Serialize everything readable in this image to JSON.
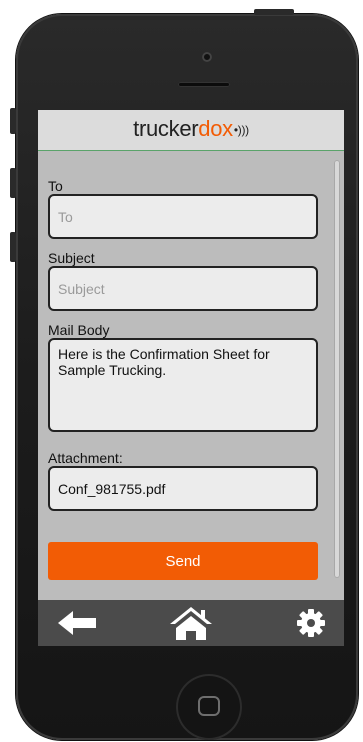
{
  "header": {
    "logo_prefix": "trucker",
    "logo_accent": "dox",
    "logo_waves": "•)))"
  },
  "form": {
    "to": {
      "label": "To",
      "placeholder": "To",
      "value": ""
    },
    "subject": {
      "label": "Subject",
      "placeholder": "Subject",
      "value": ""
    },
    "body": {
      "label": "Mail Body",
      "value": "Here is the Confirmation Sheet for Sample Trucking."
    },
    "attachment": {
      "label": "Attachment:",
      "value": "Conf_981755.pdf"
    }
  },
  "send_label": "Send",
  "nav": {
    "back_icon": "back-arrow-icon",
    "home_icon": "home-icon",
    "settings_icon": "gear-icon"
  },
  "colors": {
    "accent": "#f25c05",
    "nav_bg": "#4b4b4b",
    "header_line": "#5aa36a"
  }
}
